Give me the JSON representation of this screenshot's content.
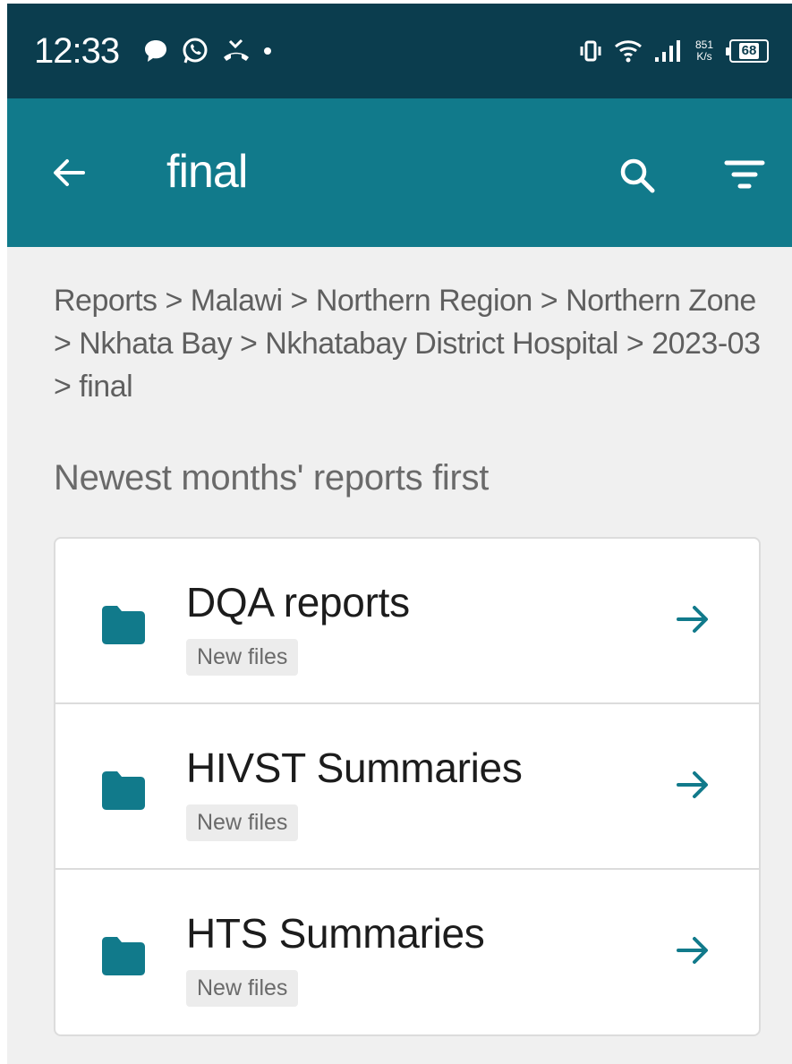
{
  "status_bar": {
    "time": "12:33",
    "net_speed_value": "851",
    "net_speed_unit": "K/s",
    "battery": "68"
  },
  "app_bar": {
    "title": "final",
    "icons": [
      "back-arrow-icon",
      "search-icon",
      "filter-icon"
    ]
  },
  "breadcrumb": {
    "text": "Reports > Malawi > Northern Region > Northern Zone > Nkhata Bay > Nkhatabay District Hospital > 2023-03 > final"
  },
  "section": {
    "title": "Newest months' reports first"
  },
  "folders": [
    {
      "name": "DQA reports",
      "badge": "New files"
    },
    {
      "name": "HIVST Summaries",
      "badge": "New files"
    },
    {
      "name": "HTS Summaries",
      "badge": "New files"
    }
  ],
  "colors": {
    "status_bar": "#0b3d4e",
    "app_bar": "#117a8b",
    "accent": "#117a8b",
    "background": "#f0f0f0"
  }
}
